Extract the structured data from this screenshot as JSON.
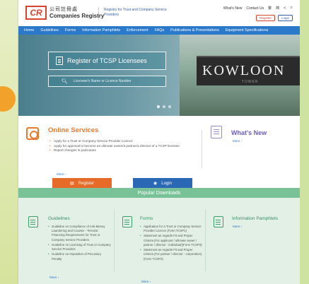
{
  "header": {
    "logo_mark": "CR",
    "logo_cn": "公司註冊處",
    "logo_en": "Companies Registry",
    "tagline": "Registry for Trust and Company Service Providers",
    "top_links": [
      "What's New",
      "Contact Us"
    ],
    "lang_items": [
      "繁",
      "简"
    ],
    "register_btn": "Register",
    "login_btn": "Login"
  },
  "nav": {
    "items": [
      "Home",
      "Guidelines",
      "Forms",
      "Information Pamphlets",
      "Enforcement",
      "FAQs",
      "Publications & Presentations",
      "Equipment Specifications"
    ]
  },
  "hero": {
    "tcsp_title": "Register of TCSP Licensees",
    "search_placeholder": "Licensee's Name or Licence Number",
    "sign_text": "KOWLOON",
    "sign_sub": "TOWER"
  },
  "online_services": {
    "title": "Online Services",
    "items": [
      "Apply for a Trust or Company Service Provider Licence",
      "Apply for approval to become an ultimate owner/a partner/a director of a TCSP licensee",
      "Report changes in particulars"
    ],
    "more": "More ›",
    "register_label": "Register",
    "login_label": "Login"
  },
  "whats_new": {
    "title": "What's New",
    "more": "More ›"
  },
  "popular_downloads": {
    "title": "Popular Downloads",
    "guidelines": {
      "title": "Guidelines",
      "items": [
        "Guideline on Compliance of Anti-Money Laundering and Counter - Terrorist Financing Requirements for Trust or Company Service Providers",
        "Guideline on Licensing of Trust or Company Service Providers",
        "Guideline on Imposition of Pecuniary Penalty"
      ],
      "more": "More ›"
    },
    "forms": {
      "title": "Forms",
      "items": [
        "Application for a Trust or Company Service Provider Licence (Form TCSP1)",
        "Statement as regards Fit and Proper Criteria (For applicant / ultimate owner / partner / director - individual)(Form TCSP3)",
        "Statement as regards Fit and Proper Criteria (For partner / director - corporation)(Form TCSP3)"
      ],
      "more": "More ›"
    },
    "pamphlets": {
      "title": "Information Pamphlets",
      "more": "More ›"
    }
  },
  "colors": {
    "nav_blue": "#2a79cb",
    "orange": "#e77a2f",
    "purple": "#6b5fb4",
    "green": "#79c297"
  }
}
